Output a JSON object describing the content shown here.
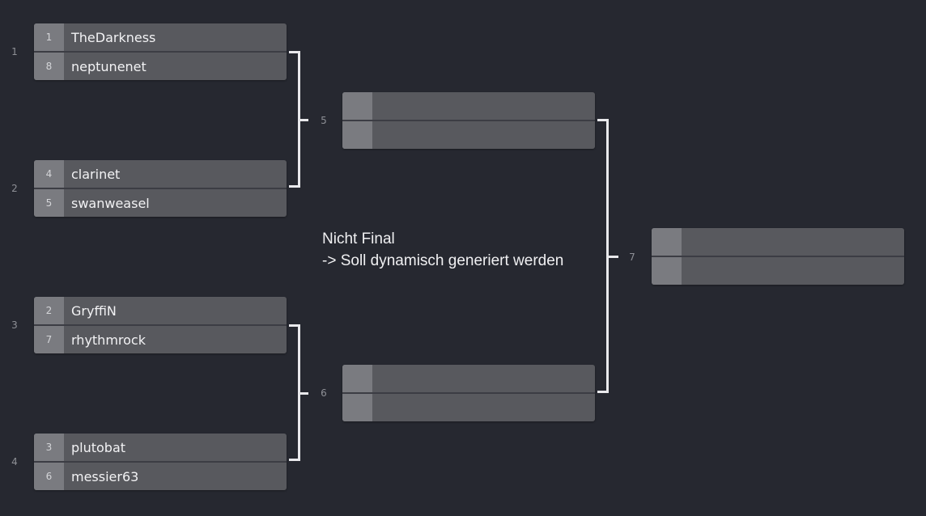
{
  "round1": [
    {
      "number": "1",
      "slots": [
        {
          "seed": "1",
          "name": "TheDarkness"
        },
        {
          "seed": "8",
          "name": "neptunenet"
        }
      ]
    },
    {
      "number": "2",
      "slots": [
        {
          "seed": "4",
          "name": "clarinet"
        },
        {
          "seed": "5",
          "name": "swanweasel"
        }
      ]
    },
    {
      "number": "3",
      "slots": [
        {
          "seed": "2",
          "name": "GryffiN"
        },
        {
          "seed": "7",
          "name": "rhythmrock"
        }
      ]
    },
    {
      "number": "4",
      "slots": [
        {
          "seed": "3",
          "name": "plutobat"
        },
        {
          "seed": "6",
          "name": "messier63"
        }
      ]
    }
  ],
  "round2": [
    {
      "number": "5",
      "slots": [
        {
          "seed": "",
          "name": ""
        },
        {
          "seed": "",
          "name": ""
        }
      ]
    },
    {
      "number": "6",
      "slots": [
        {
          "seed": "",
          "name": ""
        },
        {
          "seed": "",
          "name": ""
        }
      ]
    }
  ],
  "final": {
    "number": "7",
    "slots": [
      {
        "seed": "",
        "name": ""
      },
      {
        "seed": "",
        "name": ""
      }
    ]
  },
  "note": {
    "line1": "Nicht Final",
    "line2": "-> Soll dynamisch generiert werden"
  },
  "colors": {
    "background": "#262830",
    "slot": "#58595e",
    "seed_cell": "#7a7b80",
    "connector": "#e9e9ec"
  }
}
